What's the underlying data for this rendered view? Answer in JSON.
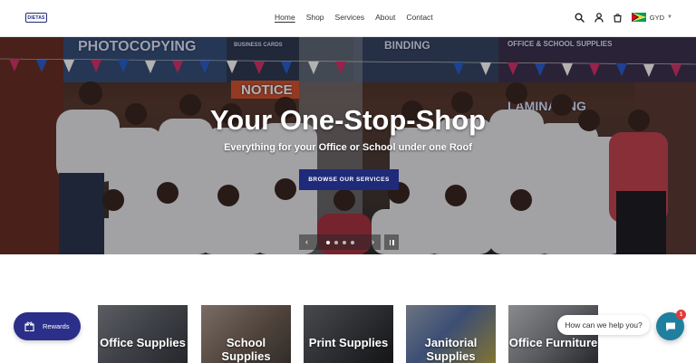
{
  "header": {
    "logo_text": "DIETAS",
    "nav": [
      {
        "label": "Home",
        "active": true
      },
      {
        "label": "Shop",
        "active": false
      },
      {
        "label": "Services",
        "active": false
      },
      {
        "label": "About",
        "active": false
      },
      {
        "label": "Contact",
        "active": false
      }
    ],
    "icons": [
      "search-icon",
      "account-icon",
      "cart-icon"
    ],
    "currency": "GYD"
  },
  "hero": {
    "banners": [
      "PHOTOCOPYING",
      "BUSINESS CARDS",
      "BINDING",
      "OFFICE & SCHOOL SUPPLIES",
      "NOTICE",
      "LAMINATING"
    ],
    "title": "Your One-Stop-Shop",
    "subtitle": "Everything for your Office or School under one Roof",
    "button_label": "BROWSE OUR SERVICES",
    "slider": {
      "slide_count": 4,
      "active_slide": 1
    }
  },
  "tiles": [
    {
      "label": "Office Supplies"
    },
    {
      "label": "School Supplies"
    },
    {
      "label": "Print Supplies"
    },
    {
      "label": "Janitorial Supplies"
    },
    {
      "label": "Office Furniture"
    }
  ],
  "rewards": {
    "label": "Rewards"
  },
  "chat": {
    "prompt": "How can we help you?",
    "badge": "1"
  },
  "colors": {
    "brand_navy": "#1f2a7a",
    "rewards": "#2b2f8a",
    "chat": "#1f7f9e",
    "badge": "#e23b3b"
  }
}
